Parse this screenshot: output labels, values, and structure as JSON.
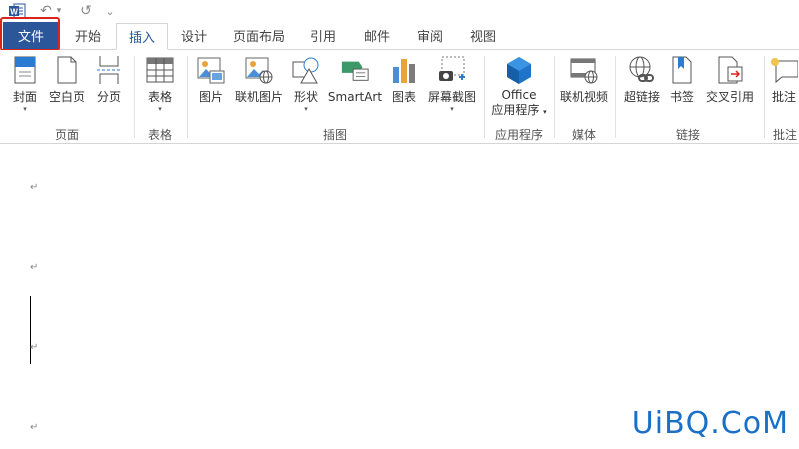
{
  "quick_access": {
    "app_icon": "word-icon",
    "app_letter": "W",
    "undo_glyph": "↶",
    "undo_dropdown_glyph": "▾",
    "redo_glyph": "↺",
    "customize_glyph": "⌄"
  },
  "tabs": [
    {
      "label": "文件"
    },
    {
      "label": "开始"
    },
    {
      "label": "插入"
    },
    {
      "label": "设计"
    },
    {
      "label": "页面布局"
    },
    {
      "label": "引用"
    },
    {
      "label": "邮件"
    },
    {
      "label": "审阅"
    },
    {
      "label": "视图"
    }
  ],
  "active_tab": "插入",
  "ribbon": {
    "buttons": {
      "cover": "封面",
      "blank_page": "空白页",
      "page_break": "分页",
      "table": "表格",
      "picture": "图片",
      "online_picture": "联机图片",
      "shapes": "形状",
      "smartart": "SmartArt",
      "chart": "图表",
      "screenshot": "屏幕截图",
      "office_line1": "Office",
      "office_line2": "应用程序",
      "online_video": "联机视频",
      "hyperlink": "超链接",
      "bookmark": "书签",
      "cross_ref": "交叉引用",
      "comment": "批注"
    },
    "groups": {
      "pages": "页面",
      "tables": "表格",
      "illustrations": "插图",
      "apps": "应用程序",
      "media": "媒体",
      "links": "链接",
      "comments": "批注"
    },
    "dropdown_glyph": "▾"
  },
  "document": {
    "paragraph_mark": "↵"
  },
  "watermark": "UiBQ.CoM",
  "colors": {
    "file_tab": "#2b579a",
    "highlight": "#d9261c",
    "watermark": "#1a70c7"
  }
}
